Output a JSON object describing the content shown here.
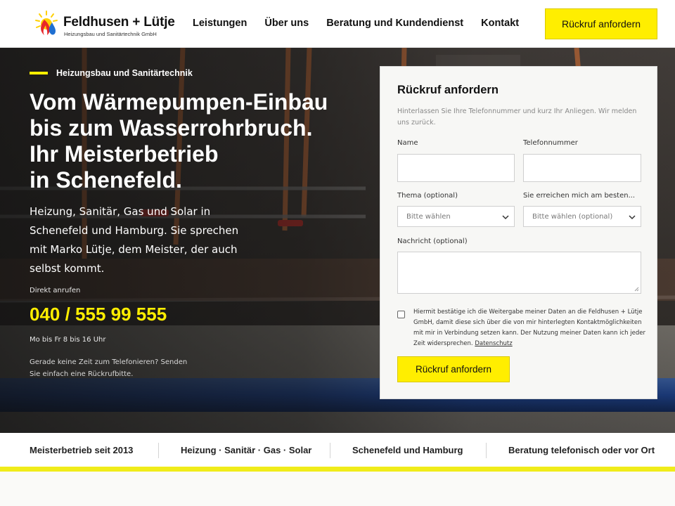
{
  "header": {
    "logo_name": "Feldhusen + Lütje",
    "logo_subtitle": "Heizungsbau und Sanitärtechnik GmbH",
    "nav": [
      "Leistungen",
      "Über uns",
      "Beratung und Kundendienst",
      "Kontakt"
    ],
    "cta_label": "Rückruf anfordern"
  },
  "hero": {
    "eyebrow": "Heizungsbau und Sanitärtechnik",
    "headline_lines": [
      "Vom Wärmepumpen-Einbau",
      "bis zum Wasserrohrbruch.",
      "Ihr Meisterbetrieb",
      "in Schenefeld."
    ],
    "intro_lines": [
      "Heizung, Sanitär, Gas und Solar in",
      "Schenefeld und Hamburg. Sie sprechen",
      "mit Marko Lütje, dem Meister, der auch",
      "selbst kommt."
    ],
    "call_label": "Direkt anrufen",
    "phone": "040 / 555 99 555",
    "hours": "Mo bis Fr 8 bis 16 Uhr",
    "alt_lines": [
      "Gerade keine Zeit zum Telefonieren? Senden",
      "Sie einfach eine Rückrufbitte."
    ]
  },
  "form": {
    "title": "Rückruf anfordern",
    "intro_lines": [
      "Hinterlassen Sie Ihre Telefonnummer und kurz Ihr Anliegen. Wir melden",
      "uns zurück."
    ],
    "name_label": "Name",
    "phone_label": "Telefonnummer",
    "topic_label": "Thema (optional)",
    "topic_selected": "Bitte wählen",
    "reach_label": "Sie erreichen mich am besten...",
    "reach_selected": "Bitte wählen (optional)",
    "message_label": "Nachricht (optional)",
    "consent_lines": [
      "Hiermit bestätige ich die Weitergabe meiner Daten an die Feldhusen + Lütje",
      "GmbH, damit diese sich über die von mir hinterlegten Kontaktmöglichkeiten",
      "mit mir in Verbindung setzen kann. Der Nutzung meiner Daten kann ich jeder",
      "Zeit widersprechen."
    ],
    "privacy_link": "Datenschutz",
    "submit_label": "Rückruf anfordern"
  },
  "trust_bar": [
    "Meisterbetrieb seit 2013",
    "Heizung · Sanitär · Gas · Solar",
    "Schenefeld und Hamburg",
    "Beratung telefonisch oder vor Ort"
  ],
  "colors": {
    "accent": "#ffee00",
    "accent_line": "#f0ec1a",
    "text_dark": "#111111"
  }
}
